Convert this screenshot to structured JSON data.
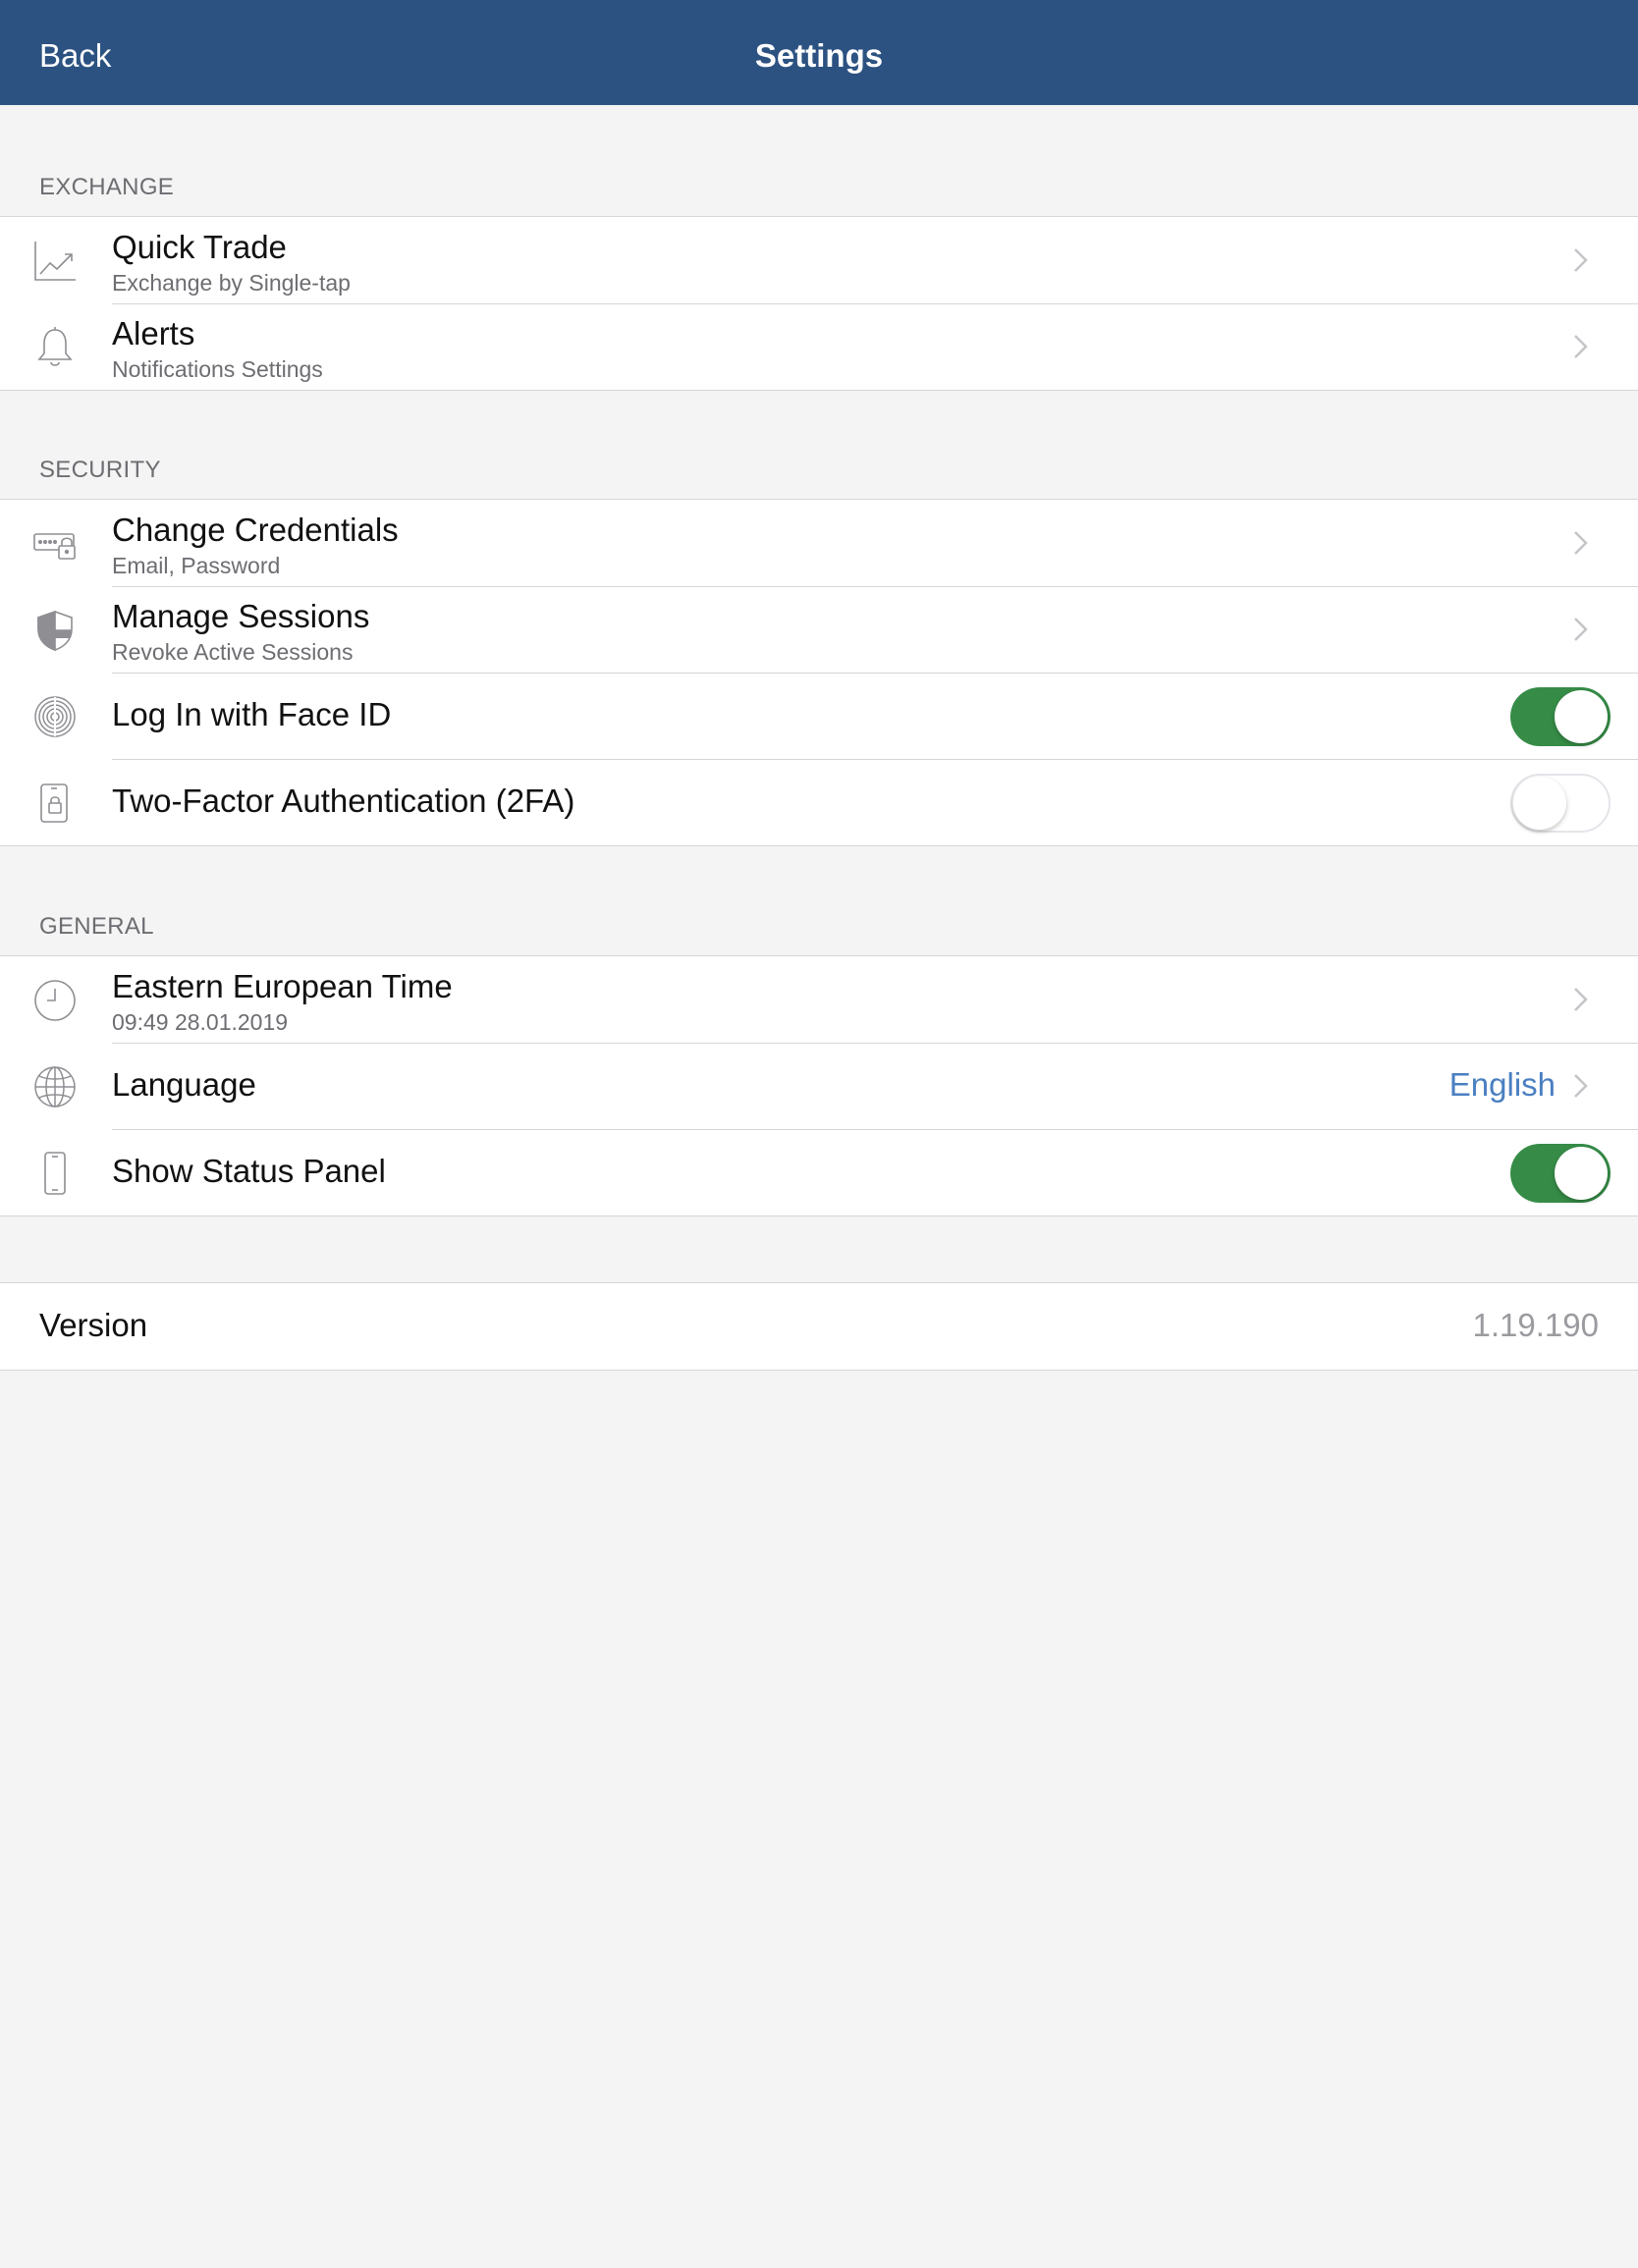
{
  "navbar": {
    "back_label": "Back",
    "title": "Settings",
    "background_color": "#2c5281"
  },
  "sections": {
    "exchange": {
      "header": "EXCHANGE",
      "items": [
        {
          "icon": "chart-trend-icon",
          "title": "Quick Trade",
          "subtitle": "Exchange by Single-tap",
          "accessory": "chevron"
        },
        {
          "icon": "bell-icon",
          "title": "Alerts",
          "subtitle": "Notifications Settings",
          "accessory": "chevron"
        }
      ]
    },
    "security": {
      "header": "SECURITY",
      "items": [
        {
          "icon": "password-lock-icon",
          "title": "Change Credentials",
          "subtitle": "Email, Password",
          "accessory": "chevron"
        },
        {
          "icon": "shield-icon",
          "title": "Manage Sessions",
          "subtitle": "Revoke Active Sessions",
          "accessory": "chevron"
        },
        {
          "icon": "fingerprint-icon",
          "title": "Log In with Face ID",
          "accessory": "toggle",
          "enabled": true
        },
        {
          "icon": "phone-lock-icon",
          "title": "Two-Factor Authentication (2FA)",
          "accessory": "toggle",
          "enabled": false
        }
      ]
    },
    "general": {
      "header": "GENERAL",
      "items": [
        {
          "icon": "clock-icon",
          "title": "Eastern European Time",
          "subtitle": "09:49 28.01.2019",
          "accessory": "chevron"
        },
        {
          "icon": "globe-icon",
          "title": "Language",
          "value": "English",
          "accessory": "chevron"
        },
        {
          "icon": "phone-icon",
          "title": "Show Status Panel",
          "accessory": "toggle",
          "enabled": true
        }
      ]
    }
  },
  "version": {
    "label": "Version",
    "value": "1.19.190"
  },
  "colors": {
    "toggle_on": "#368c47",
    "accent_value": "#4a7fc1",
    "background": "#f4f4f4"
  }
}
